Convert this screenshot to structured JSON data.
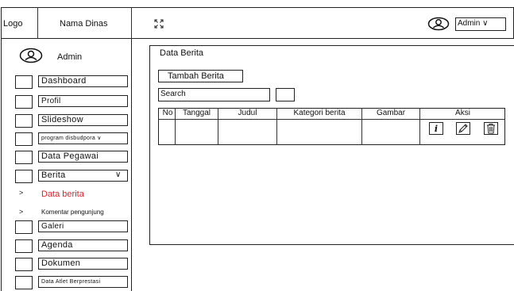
{
  "header": {
    "logo": "Logo",
    "dinas": "Nama Dinas",
    "admin_dropdown": "Admin ∨"
  },
  "sidebar": {
    "user_name": "Admin",
    "items": [
      {
        "label": "Dashboard"
      },
      {
        "label": "Profil"
      },
      {
        "label": "Slideshow"
      },
      {
        "label": "program disbudpora ∨"
      },
      {
        "label": "Data Pegawai"
      },
      {
        "label": "Berita"
      },
      {
        "label": "Galeri"
      },
      {
        "label": "Agenda"
      },
      {
        "label": "Dokumen"
      },
      {
        "label": "Data Atlet Berprestasi"
      }
    ],
    "berita_chevron": "∨",
    "subitems": [
      {
        "arrow": ">",
        "label": "Data berita"
      },
      {
        "arrow": ">",
        "label": "Komentar pengunjung"
      }
    ],
    "active_color": "#e0202a"
  },
  "main": {
    "title": "Data Berita",
    "add_button": "Tambah Berita",
    "search_value": "Search",
    "table": {
      "headers": [
        "No",
        "Tanggal",
        "Judul",
        "Kategori berita",
        "Gambar",
        "Aksi"
      ]
    },
    "action_icons": [
      "info-icon",
      "edit-pencil-icon",
      "trash-icon"
    ]
  }
}
